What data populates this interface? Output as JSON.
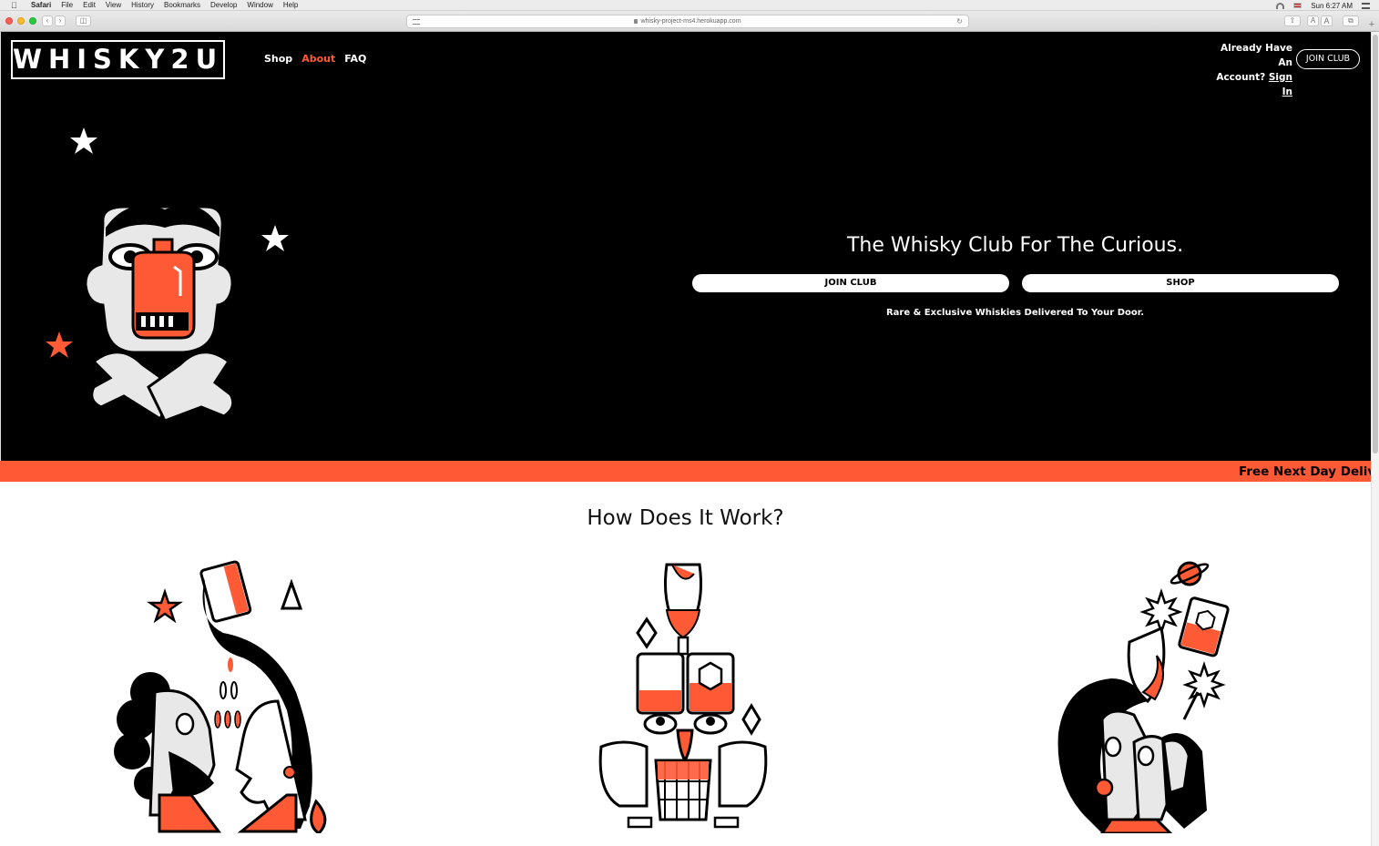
{
  "menubar": {
    "app": "Safari",
    "items": [
      "File",
      "Edit",
      "View",
      "History",
      "Bookmarks",
      "Develop",
      "Window",
      "Help"
    ],
    "clock": "Sun 6:27 AM"
  },
  "browser": {
    "url": "whisky-project-ms4.herokuapp.com",
    "text_size_small": "A",
    "text_size_large": "A"
  },
  "site": {
    "logo": "WHISKY2U",
    "nav": [
      {
        "label": "Shop",
        "active": false
      },
      {
        "label": "About",
        "active": true
      },
      {
        "label": "FAQ",
        "active": false
      }
    ],
    "account_prompt_line1": "Already Have An",
    "account_prompt_line2": "Account?",
    "sign_in": "Sign In",
    "join_club_top": "JOIN CLUB",
    "accent_color": "#ff5a36"
  },
  "hero": {
    "title": "The Whisky Club For The Curious.",
    "join_button": "JOIN CLUB",
    "shop_button": "SHOP",
    "subtitle": "Rare & Exclusive Whiskies Delivered To Your Door."
  },
  "ticker": {
    "text": "Free Next Day Delive"
  },
  "how_it_works": {
    "title": "How Does It Work?"
  }
}
